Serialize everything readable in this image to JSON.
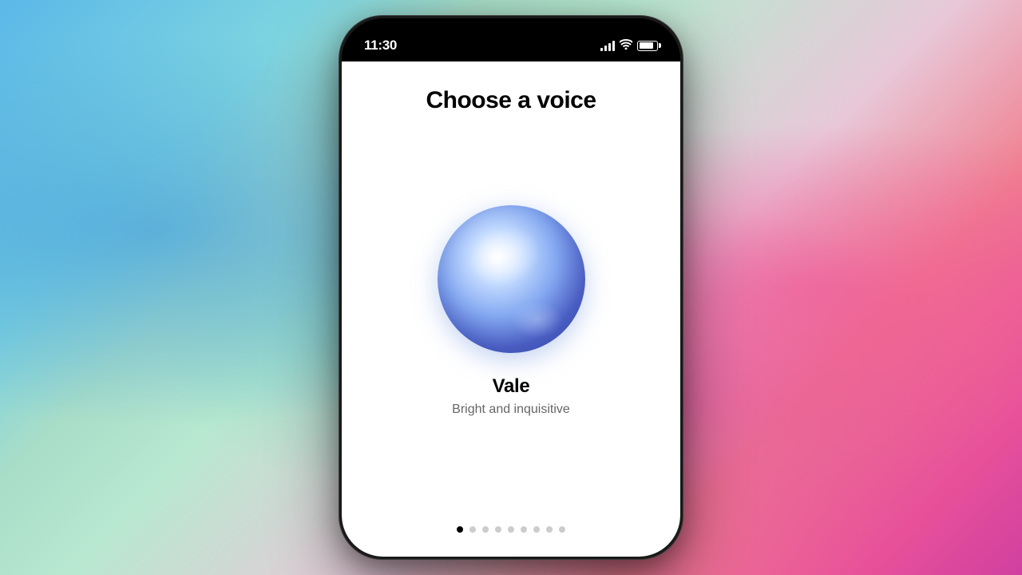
{
  "background": {
    "description": "Colorful painted background"
  },
  "status_bar": {
    "time": "11:30",
    "signal_strength": 3,
    "battery_percent": 85
  },
  "screen": {
    "title": "Choose a voice",
    "voice": {
      "name": "Vale",
      "description": "Bright and inquisitive"
    },
    "pagination": {
      "total_dots": 9,
      "active_dot": 0
    }
  }
}
